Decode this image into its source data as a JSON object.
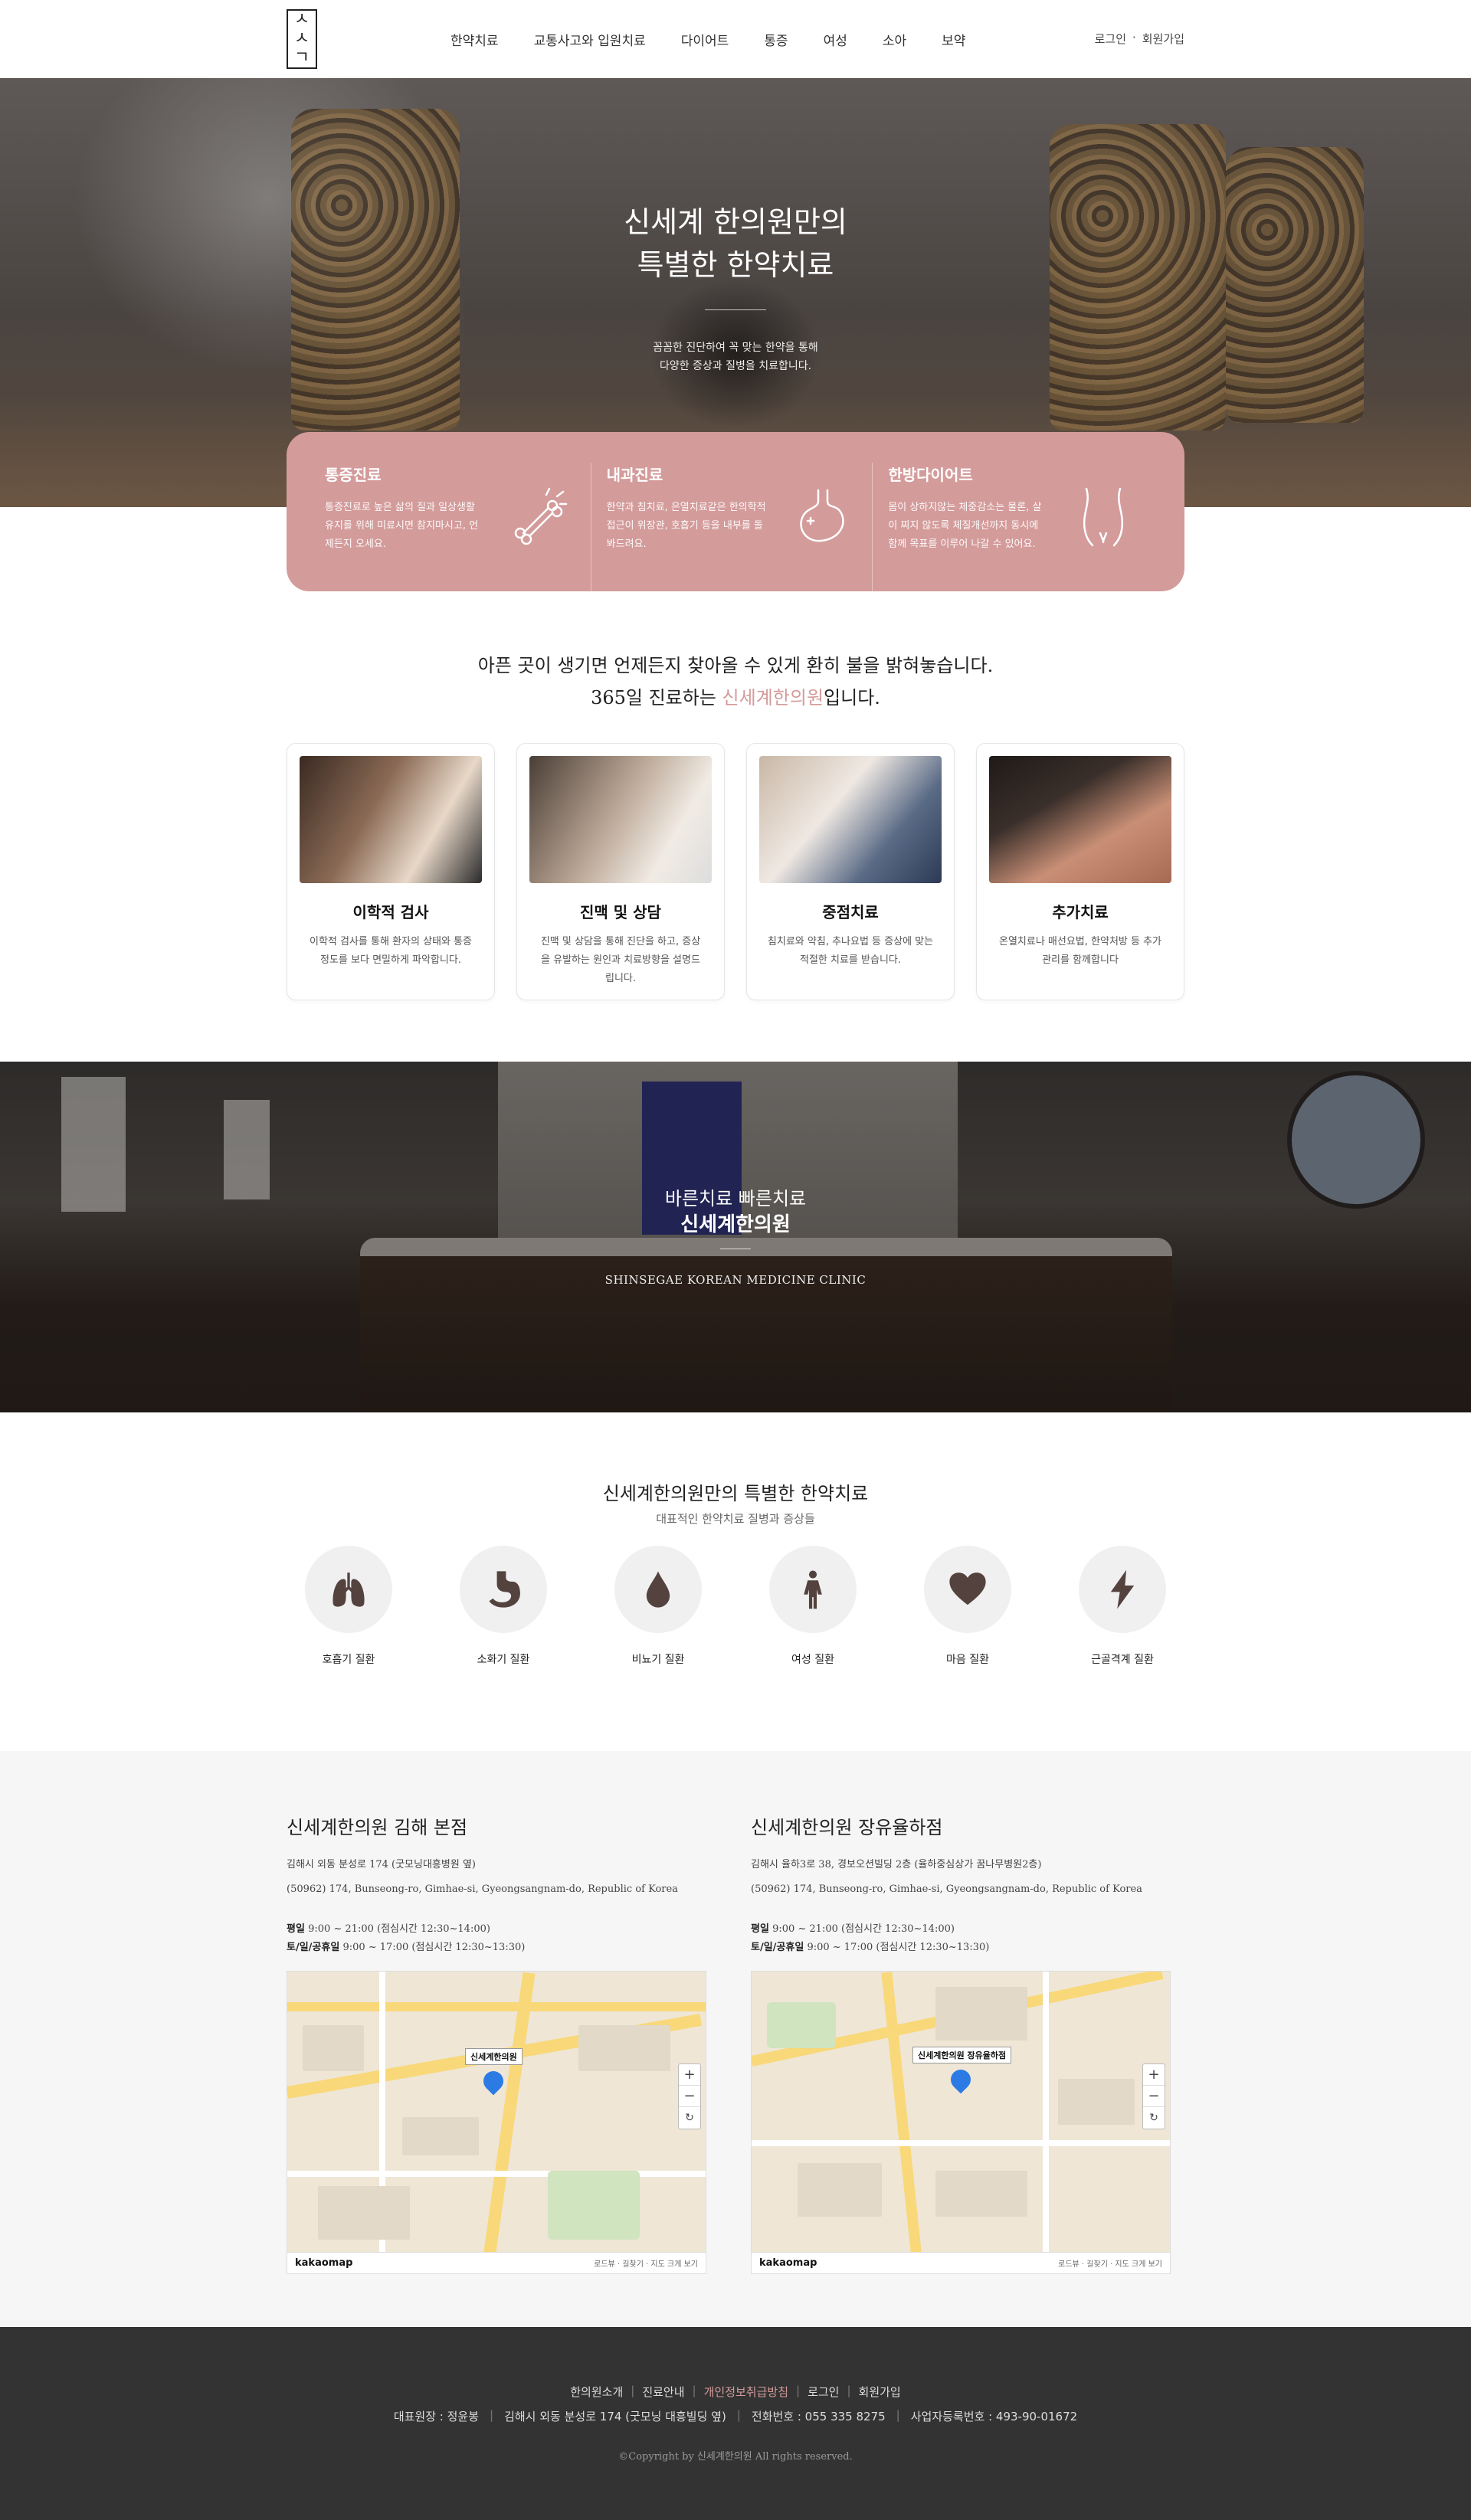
{
  "header": {
    "logo_text": "신세계",
    "nav": [
      "한약치료",
      "교통사고와 입원치료",
      "다이어트",
      "통증",
      "여성",
      "소아",
      "보약"
    ],
    "login": "로그인",
    "separator": "·",
    "signup": "회원가입"
  },
  "hero": {
    "title_line1": "신세계 한의원만의",
    "title_line2": "특별한 한약치료",
    "sub_line1": "꼼꼼한 진단하여 꼭 맞는 한약을 통해",
    "sub_line2": "다양한 증상과 질병을 치료합니다."
  },
  "features": [
    {
      "title": "통증진료",
      "desc": "통증진료로 높은 삶의 질과 일상생활 유지를 위해 미료시면 참지마시고, 언제든지 오세요.",
      "icon": "bone-icon"
    },
    {
      "title": "내과진료",
      "desc": "한약과 침치료, 은열치료같은 한의학적 접근이 위장관, 호흡기 등을 내부를 돌봐드려요.",
      "icon": "stomach-icon"
    },
    {
      "title": "한방다이어트",
      "desc": "몸이 상하지않는 체중감소는 물론, 살이 찌지 않도록 체질개선까지 동시에 함께 목표를 이루어 나갈 수 있어요.",
      "icon": "body-shape-icon"
    }
  ],
  "intro": {
    "line1": "아픈 곳이 생기면 언제든지 찾아올 수 있게 환히 불을 밝혀놓습니다.",
    "line2_pre": "365일 진료하는 ",
    "line2_hl": "신세계한의원",
    "line2_post": "입니다."
  },
  "services": [
    {
      "title": "이학적 검사",
      "desc": "이학적 검사를 통해 환자의 상태와 통증 정도를 보다 면밀하게 파악합니다."
    },
    {
      "title": "진맥 및 상담",
      "desc": "진맥 및 상담을 통해 진단을 하고, 증상을 유발하는 원인과 치료방향을 설명드립니다."
    },
    {
      "title": "중점치료",
      "desc": "침치료와 약침, 추나요법 등 증상에 맞는 적절한 치료를 받습니다."
    },
    {
      "title": "추가치료",
      "desc": "온열치료나 매선요법, 한약처방 등 추가 관리를 함께합니다"
    }
  ],
  "band": {
    "line1": "바른치료 빠른치료",
    "line2": "신세계한의원",
    "english": "SHINSEGAE KOREAN MEDICINE CLINIC"
  },
  "treatments": {
    "title": "신세계한의원만의 특별한 한약치료",
    "subtitle": "대표적인 한약치료 질병과 증상들",
    "items": [
      {
        "label": "호흡기 질환",
        "icon": "lungs-icon"
      },
      {
        "label": "소화기 질환",
        "icon": "stomach-icon"
      },
      {
        "label": "비뇨기 질환",
        "icon": "drop-icon"
      },
      {
        "label": "여성 질환",
        "icon": "woman-icon"
      },
      {
        "label": "마음 질환",
        "icon": "heart-icon"
      },
      {
        "label": "근골격계 질환",
        "icon": "lightning-icon"
      }
    ]
  },
  "branches": [
    {
      "name": "신세계한의원 김해 본점",
      "addr_ko": "김해시 외동 분성로 174 (굿모닝대흥병원 옆)",
      "addr_en": "(50962) 174, Bunseong-ro, Gimhae-si, Gyeongsangnam-do, Republic of Korea",
      "weekday_label": "평일",
      "weekday": "9:00 ~ 21:00 (점심시간 12:30~14:00)",
      "weekend_label": "토/일/공휴일",
      "weekend": "9:00 ~ 17:00 (점심시간 12:30~13:30)",
      "map_tag": "신세계한의원"
    },
    {
      "name": "신세계한의원 장유율하점",
      "addr_ko": "김해시 율하3로 38, 경보오션빌딩 2층 (율하중심상가 꿈나무병원2층)",
      "addr_en": "(50962) 174, Bunseong-ro, Gimhae-si, Gyeongsangnam-do, Republic of Korea",
      "weekday_label": "평일",
      "weekday": "9:00 ~ 21:00 (점심시간 12:30~14:00)",
      "weekend_label": "토/일/공휴일",
      "weekend": "9:00 ~ 17:00 (점심시간 12:30~13:30)",
      "map_tag": "신세계한의원 장유율하점"
    }
  ],
  "map_ui": {
    "brand": "kakaomap",
    "links": "로드뷰 · 길찾기 · 지도 크게 보기",
    "zoom_in": "+",
    "zoom_out": "−",
    "refresh": "↻"
  },
  "footer": {
    "nav": [
      "한의원소개",
      "진료안내",
      "개인정보취급방침",
      "로그인",
      "회원가입"
    ],
    "sep": "|",
    "director": "대표원장 : 정윤봉",
    "address": "김해시 외동 분성로 174 (굿모닝 대흥빌딩 옆)",
    "phone": "전화번호 : 055 335 8275",
    "bizno": "사업자등록번호 : 493-90-01672",
    "copyright": "©Copyright by 신세계한의원 All rights reserved."
  }
}
